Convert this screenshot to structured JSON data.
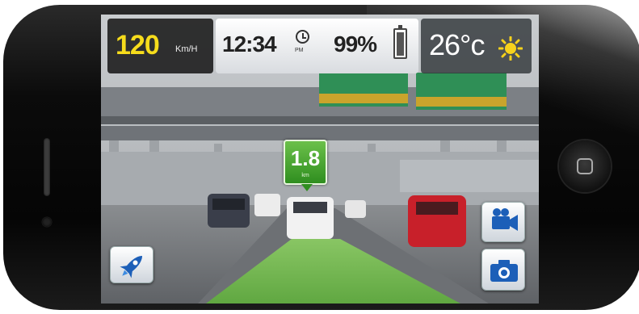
{
  "hud": {
    "speed": {
      "value": "120",
      "unit": "Km/H"
    },
    "time": {
      "value": "12:34",
      "period": "PM"
    },
    "battery": {
      "percent": "99%",
      "level": 0.85
    },
    "weather": {
      "temperature": "26°c",
      "condition_icon": "sun-icon"
    }
  },
  "distance_marker": {
    "value": "1.8",
    "unit": "km"
  },
  "buttons": {
    "launch": {
      "icon": "rocket-icon"
    },
    "video": {
      "icon": "video-camera-icon"
    },
    "photo": {
      "icon": "camera-icon"
    }
  },
  "colors": {
    "speed_text": "#f6dc1c",
    "marker_green": "#3c9b2a",
    "lane_green": "#7ecb5a",
    "button_icon_blue": "#1c5fb8"
  }
}
